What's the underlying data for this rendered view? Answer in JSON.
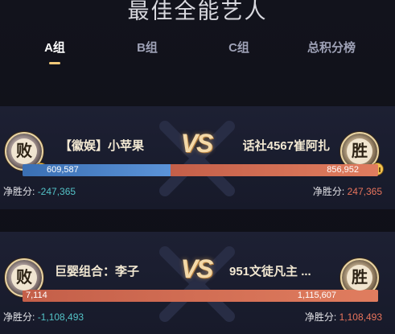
{
  "title": "最佳全能艺人",
  "tabs": [
    {
      "label": "A组",
      "active": true
    },
    {
      "label": "B组",
      "active": false
    },
    {
      "label": "C组",
      "active": false
    },
    {
      "label": "总积分榜",
      "active": false
    }
  ],
  "matches": [
    {
      "vs": "VS",
      "left": {
        "badge": "败",
        "name": "【徽娱】小苹果",
        "score": "609,587",
        "net_label": "净胜分:",
        "net_value": "-247,365"
      },
      "right": {
        "badge": "胜",
        "name": "话社4567崔阿扎",
        "score": "856,952",
        "net_label": "净胜分:",
        "net_value": "247,365"
      },
      "left_share": 0.416
    },
    {
      "vs": "VS",
      "left": {
        "badge": "败",
        "name": "巨婴组合：李子",
        "score": "7,114",
        "net_label": "净胜分:",
        "net_value": "-1,108,493"
      },
      "right": {
        "badge": "胜",
        "name": "951文徒凡主 ...",
        "score": "1,115,607",
        "net_label": "净胜分:",
        "net_value": "1,108,493"
      },
      "left_share": 0.006
    }
  ],
  "colors": {
    "accent_gold": "#f0c878",
    "bar_blue": "#4a85cc",
    "bar_red": "#d46f55",
    "net_negative": "#53c3c7",
    "net_positive": "#e8745c"
  }
}
